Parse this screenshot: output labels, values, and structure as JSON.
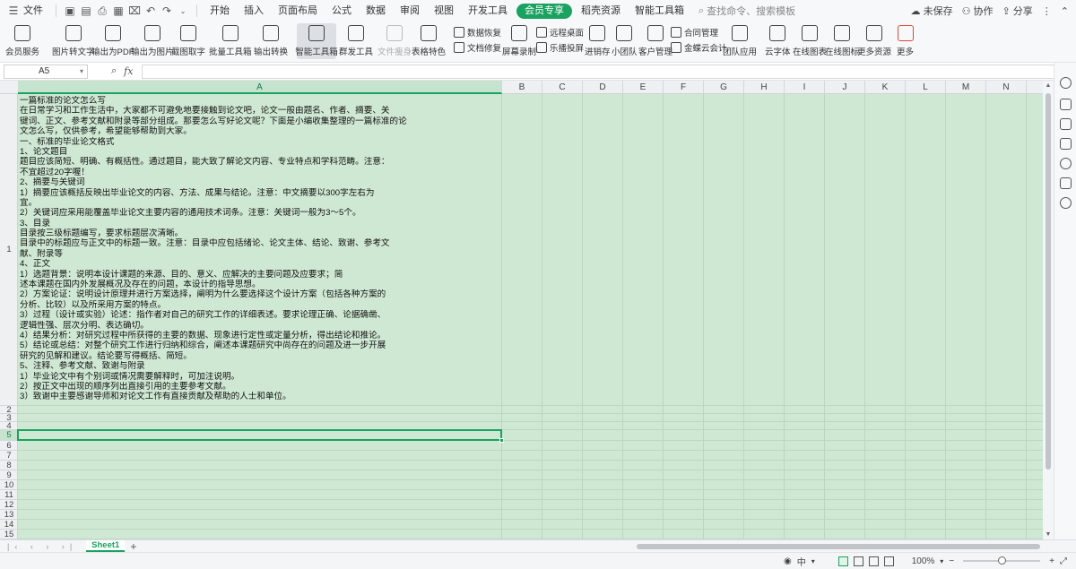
{
  "menubar": {
    "file": "文件",
    "tabs": [
      "开始",
      "插入",
      "页面布局",
      "公式",
      "数据",
      "审阅",
      "视图",
      "开发工具",
      "会员专享",
      "稻壳资源",
      "智能工具箱"
    ],
    "active_tab": "会员专享",
    "search_placeholder": "查找命令、搜索模板",
    "unsaved": "未保存",
    "collab": "协作",
    "share": "分享"
  },
  "ribbon": {
    "member_service": "会员服务",
    "img_to_text": "图片转文字",
    "export_pdf": "输出为PDF",
    "export_img": "输出为图片",
    "screenshot": "截图取字",
    "batch_tools": "批量工具箱",
    "export_convert": "输出转换",
    "smart_toolbox": "智能工具箱",
    "group_send": "群发工具",
    "doc_slim": "文件瘦身",
    "table_feature": "表格特色",
    "data_recover": "数据恢复",
    "doc_repair": "文档修复",
    "screen_record": "屏幕录制",
    "remote_desktop": "远程桌面",
    "cast_screen": "乐播投屏",
    "inventory": "进销存",
    "small_team": "小团队",
    "crm": "客户管理",
    "contract": "合同管理",
    "jindie": "金蝶云会计",
    "team_app": "团队应用",
    "cloud_font": "云字体",
    "online_chart": "在线图表",
    "online_icon": "在线图标",
    "more_res": "更多资源",
    "more": "更多"
  },
  "formula_bar": {
    "cell_ref": "A5",
    "fx": "fx",
    "value": ""
  },
  "grid": {
    "columns": [
      "A",
      "B",
      "C",
      "D",
      "E",
      "F",
      "G",
      "H",
      "I",
      "J",
      "K",
      "L",
      "M",
      "N"
    ],
    "rows": [
      "1",
      "2",
      "3",
      "4",
      "5",
      "6",
      "7",
      "8",
      "9",
      "10",
      "11",
      "12",
      "13",
      "14",
      "15"
    ],
    "selected_col": "A",
    "selected_row": "5",
    "a1_lines": [
      "    一篇标准的论文怎么写",
      "    在日常学习和工作生活中，大家都不可避免地要接触到论文吧，论文一般由题名、作者、摘要、关",
      "键词、正文、参考文献和附录等部分组成。那要怎么写好论文呢？下面是小编收集整理的一篇标准的论",
      "文怎么写，仅供参考，希望能够帮助到大家。",
      "    一、标准的毕业论文格式",
      "    1、论文题目",
      "    题目应该简短、明确、有概括性。通过题目，能大致了解论文内容、专业特点和学科范畴。注意：",
      "不宜超过20字喔！",
      "    2、摘要与关键词",
      "    1）摘要应该概括反映出毕业论文的内容、方法、成果与结论。注意：中文摘要以300字左右为",
      "宜。",
      "    2）关键词应采用能覆盖毕业论文主要内容的通用技术词条。注意：关键词一般为3～5个。",
      "    3、目录",
      "    目录按三级标题编写，要求标题层次清晰。",
      "    目录中的标题应与正文中的标题一致。注意：目录中应包括绪论、论文主体、结论、致谢、参考文",
      "献、附录等",
      "    4、正文",
      "    1）选题背景：说明本设计课题的来源、目的、意义、应解决的主要问题及应要求；简",
      "述本课题在国内外发展概况及存在的问题，本设计的指导思想。",
      "    2）方案论证：说明设计原理并进行方案选择，阐明为什么要选择这个设计方案（包括各种方案的",
      "分析、比较）以及所采用方案的特点。",
      "    3）过程（设计或实验）论述：指作者对自己的研究工作的详细表述。要求论理正确、论据确凿、",
      "逻辑性强、层次分明、表达确切。",
      "    4）结果分析：对研究过程中所获得的主要的数据、现象进行定性或定量分析，得出结论和推论。",
      "    5）结论或总结：对整个研究工作进行归纳和综合，阐述本课题研究中尚存在的问题及进一步开展",
      "研究的见解和建议。结论要写得概括、简短。",
      "    5、注释、参考文献、致谢与附录",
      "    1）毕业论文中有个别词或情况需要解释时，可加注说明。",
      "    2）按正文中出现的顺序列出直接引用的主要参考文献。",
      "    3）致谢中主要感谢导师和对论文工作有直接贡献及帮助的人士和单位。"
    ]
  },
  "sheets": {
    "active": "Sheet1",
    "add": "+"
  },
  "status": {
    "input_mode": "中",
    "zoom": "100%",
    "zoom_level": 1.0
  }
}
